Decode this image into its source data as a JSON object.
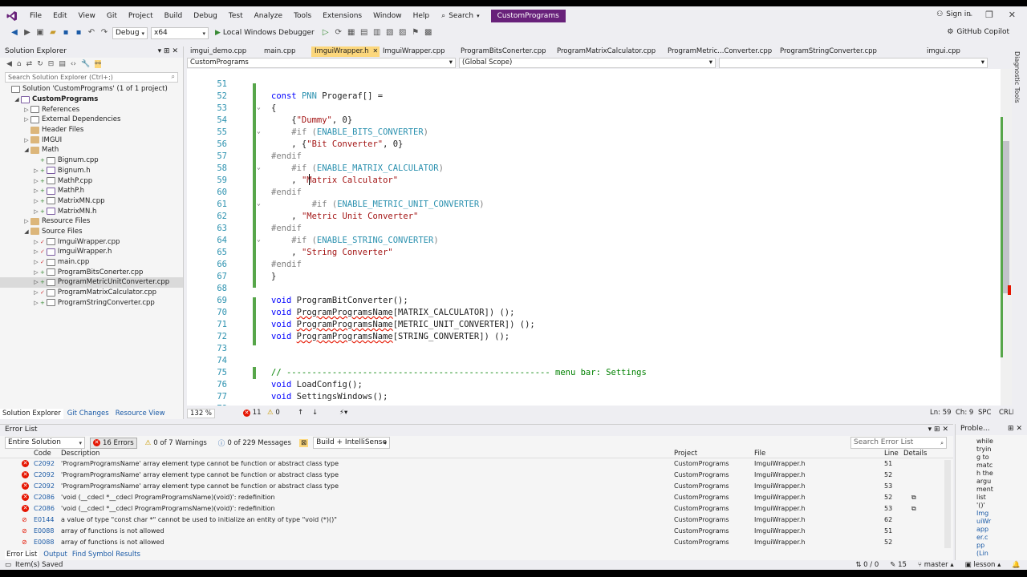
{
  "menu": {
    "items": [
      "File",
      "Edit",
      "View",
      "Git",
      "Project",
      "Build",
      "Debug",
      "Test",
      "Analyze",
      "Tools",
      "Extensions",
      "Window",
      "Help"
    ],
    "search": "Search",
    "project_title": "CustomPrograms",
    "signin": "Sign in"
  },
  "toolbar": {
    "config": "Debug",
    "platform": "x64",
    "run": "Local Windows Debugger",
    "copilot": "GitHub Copilot"
  },
  "solution_explorer": {
    "title": "Solution Explorer",
    "search_placeholder": "Search Solution Explorer (Ctrl+;)",
    "items": [
      {
        "label": "Solution 'CustomPrograms' (1 of 1 project)",
        "indent": 0,
        "kind": "sln",
        "bold": false
      },
      {
        "label": "CustomPrograms",
        "indent": 1,
        "kind": "proj",
        "bold": true,
        "exp": "◢"
      },
      {
        "label": "References",
        "indent": 2,
        "kind": "ref",
        "exp": "▷"
      },
      {
        "label": "External Dependencies",
        "indent": 2,
        "kind": "ref",
        "exp": "▷"
      },
      {
        "label": "Header Files",
        "indent": 2,
        "kind": "folder",
        "exp": ""
      },
      {
        "label": "IMGUI",
        "indent": 2,
        "kind": "folder",
        "exp": "▷"
      },
      {
        "label": "Math",
        "indent": 2,
        "kind": "folder",
        "exp": "◢"
      },
      {
        "label": "Bignum.cpp",
        "indent": 3,
        "kind": "cpp",
        "exp": "",
        "lock": "+ ⚿"
      },
      {
        "label": "Bignum.h",
        "indent": 3,
        "kind": "h",
        "exp": "▷",
        "lock": "+ ⚿"
      },
      {
        "label": "MathP.cpp",
        "indent": 3,
        "kind": "cpp",
        "exp": "▷",
        "lock": "+ ⚿"
      },
      {
        "label": "MathP.h",
        "indent": 3,
        "kind": "h",
        "exp": "▷",
        "lock": "+ ⚿"
      },
      {
        "label": "MatrixMN.cpp",
        "indent": 3,
        "kind": "cpp",
        "exp": "▷",
        "lock": "+ ⚿"
      },
      {
        "label": "MatrixMN.h",
        "indent": 3,
        "kind": "h",
        "exp": "▷",
        "lock": "+ ⚿"
      },
      {
        "label": "Resource Files",
        "indent": 2,
        "kind": "folder",
        "exp": "▷"
      },
      {
        "label": "Source Files",
        "indent": 2,
        "kind": "folder",
        "exp": "◢"
      },
      {
        "label": "ImguiWrapper.cpp",
        "indent": 3,
        "kind": "cpp",
        "exp": "▷",
        "lock": "✓ ⚿"
      },
      {
        "label": "ImguiWrapper.h",
        "indent": 3,
        "kind": "h",
        "exp": "▷",
        "lock": "✓ ⚿"
      },
      {
        "label": "main.cpp",
        "indent": 3,
        "kind": "cpp",
        "exp": "▷",
        "lock": "✓ ⚿"
      },
      {
        "label": "ProgramBitsConerter.cpp",
        "indent": 3,
        "kind": "cpp",
        "exp": "▷",
        "lock": "+ +"
      },
      {
        "label": "ProgramMetricUnitConverter.cpp",
        "indent": 3,
        "kind": "cpp",
        "exp": "▷",
        "lock": "+ +",
        "selected": true
      },
      {
        "label": "ProgramMatrixCalculator.cpp",
        "indent": 3,
        "kind": "cpp",
        "exp": "▷",
        "lock": "✓ ⚿"
      },
      {
        "label": "ProgramStringConverter.cpp",
        "indent": 3,
        "kind": "cpp",
        "exp": "▷",
        "lock": "+ +"
      }
    ],
    "tabs": [
      "Solution Explorer",
      "Git Changes",
      "Resource View"
    ]
  },
  "editor": {
    "tabs": [
      "imgui_demo.cpp",
      "main.cpp",
      "ImguiWrapper.h",
      "ImguiWrapper.cpp",
      "ProgramBitsConerter.cpp",
      "ProgramMatrixCalculator.cpp",
      "ProgramMetric...Converter.cpp",
      "ProgramStringConverter.cpp",
      "imgui.cpp"
    ],
    "active_tab": "ImguiWrapper.h",
    "nav_project": "CustomPrograms",
    "nav_scope": "(Global Scope)",
    "zoom": "132 %",
    "errors": "11",
    "warnings": "0",
    "position": "Ln: 59",
    "col": "Ch: 9",
    "spc": "SPC",
    "crlf": "CRLF",
    "lines": [
      {
        "n": "51",
        "html": ""
      },
      {
        "n": "52",
        "html": "<span class=\"kw\">const</span> <span class=\"ty\">PNN</span> Progeraf[] ="
      },
      {
        "n": "53",
        "html": "{"
      },
      {
        "n": "54",
        "html": "    {<span class=\"str\">\"Dummy\"</span>, 0}"
      },
      {
        "n": "55",
        "html": "    <span class=\"pp\">#if (</span><span class=\"ty\">ENABLE_BITS_CONVERTER</span><span class=\"pp\">)</span>"
      },
      {
        "n": "56",
        "html": "    , {<span class=\"str\">\"Bit Converter\"</span>, 0}"
      },
      {
        "n": "57",
        "html": "<span class=\"pp\">#endif</span>"
      },
      {
        "n": "58",
        "html": "    <span class=\"pp\">#if (</span><span class=\"ty\">ENABLE_MATRIX_CALCULATOR</span><span class=\"pp\">)</span>"
      },
      {
        "n": "59",
        "html": "    , <span class=\"str\">\"Matrix Calculator\"</span>"
      },
      {
        "n": "60",
        "html": "<span class=\"pp\">#endif</span>"
      },
      {
        "n": "61",
        "html": "        <span class=\"pp\">#if (</span><span class=\"ty\">ENABLE_METRIC_UNIT_CONVERTER</span><span class=\"pp\">)</span>"
      },
      {
        "n": "62",
        "html": "    , <span class=\"str\">\"Metric Unit Converter\"</span>"
      },
      {
        "n": "63",
        "html": "<span class=\"pp\">#endif</span>"
      },
      {
        "n": "64",
        "html": "    <span class=\"pp\">#if (</span><span class=\"ty\">ENABLE_STRING_CONVERTER</span><span class=\"pp\">)</span>"
      },
      {
        "n": "65",
        "html": "    , <span class=\"str\">\"String Converter\"</span>"
      },
      {
        "n": "66",
        "html": "<span class=\"pp\">#endif</span>"
      },
      {
        "n": "67",
        "html": "}"
      },
      {
        "n": "68",
        "html": ""
      },
      {
        "n": "69",
        "html": "<span class=\"kw\">void</span> ProgramBitConverter();"
      },
      {
        "n": "70",
        "html": "<span class=\"kw\">void</span> <span class=\"sq\">ProgramProgramsName</span>[MATRIX_CALCULATOR]) ();"
      },
      {
        "n": "71",
        "html": "<span class=\"kw\">void</span> <span class=\"sq\">ProgramProgramsName</span>[METRIC_UNIT_CONVERTER]) ();"
      },
      {
        "n": "72",
        "html": "<span class=\"kw\">void</span> <span class=\"sq\">ProgramProgramsName</span>[STRING_CONVERTER]) ();"
      },
      {
        "n": "73",
        "html": ""
      },
      {
        "n": "74",
        "html": ""
      },
      {
        "n": "75",
        "html": "<span class=\"cm\">// ---------------------------------------------------- menu bar: Settings</span>"
      },
      {
        "n": "76",
        "html": "<span class=\"kw\">void</span> LoadConfig();"
      },
      {
        "n": "77",
        "html": "<span class=\"kw\">void</span> SettingsWindows();"
      },
      {
        "n": "78",
        "html": ""
      }
    ]
  },
  "errorlist": {
    "title": "Error List",
    "scope": "Entire Solution",
    "errors_btn": "16 Errors",
    "warnings_btn": "0 of 7 Warnings",
    "messages_btn": "0 of 229 Messages",
    "build_filter": "Build + IntelliSense",
    "search_placeholder": "Search Error List",
    "headers": {
      "code": "Code",
      "description": "Description",
      "project": "Project",
      "file": "File",
      "line": "Line",
      "details": "Details"
    },
    "rows": [
      {
        "code": "C2092",
        "desc": "'ProgramProgramsName' array element type cannot be function or abstract class type",
        "project": "CustomPrograms",
        "file": "ImguiWrapper.h",
        "line": "51",
        "type": "err"
      },
      {
        "code": "C2092",
        "desc": "'ProgramProgramsName' array element type cannot be function or abstract class type",
        "project": "CustomPrograms",
        "file": "ImguiWrapper.h",
        "line": "52",
        "type": "err"
      },
      {
        "code": "C2092",
        "desc": "'ProgramProgramsName' array element type cannot be function or abstract class type",
        "project": "CustomPrograms",
        "file": "ImguiWrapper.h",
        "line": "53",
        "type": "err"
      },
      {
        "code": "C2086",
        "desc": "'void (__cdecl *__cdecl ProgramProgramsName)(void)': redefinition",
        "project": "CustomPrograms",
        "file": "ImguiWrapper.h",
        "line": "52",
        "type": "err",
        "details": true
      },
      {
        "code": "C2086",
        "desc": "'void (__cdecl *__cdecl ProgramProgramsName)(void)': redefinition",
        "project": "CustomPrograms",
        "file": "ImguiWrapper.h",
        "line": "53",
        "type": "err",
        "details": true
      },
      {
        "code": "E0144",
        "desc": "a value of type \"const char *\" cannot be used to initialize an entity of type \"void (*)()\"",
        "project": "CustomPrograms",
        "file": "ImguiWrapper.h",
        "line": "62",
        "type": "ie"
      },
      {
        "code": "E0088",
        "desc": "array of functions is not allowed",
        "project": "CustomPrograms",
        "file": "ImguiWrapper.h",
        "line": "51",
        "type": "ie"
      },
      {
        "code": "E0088",
        "desc": "array of functions is not allowed",
        "project": "CustomPrograms",
        "file": "ImguiWrapper.h",
        "line": "52",
        "type": "ie"
      }
    ],
    "tabs": [
      "Error List",
      "Output",
      "Find Symbol Results"
    ]
  },
  "problem_details": {
    "title": "Proble...",
    "text": [
      "while",
      "tryin",
      "g to",
      "matc",
      "h the",
      "argu",
      "ment",
      "list",
      "'()'"
    ],
    "link": [
      "Img",
      "uiWr",
      "app",
      "er.c",
      "pp",
      "(Lin"
    ]
  },
  "statusbar": {
    "saved": "Item(s) Saved",
    "nav": "0 / 0",
    "changes": "15",
    "branch": "master",
    "repo": "lesson"
  },
  "diag_label": "Diagnostic Tools",
  "colors": {
    "accent": "#68217a",
    "active_tab": "#fcd77c",
    "error": "#e51400"
  }
}
